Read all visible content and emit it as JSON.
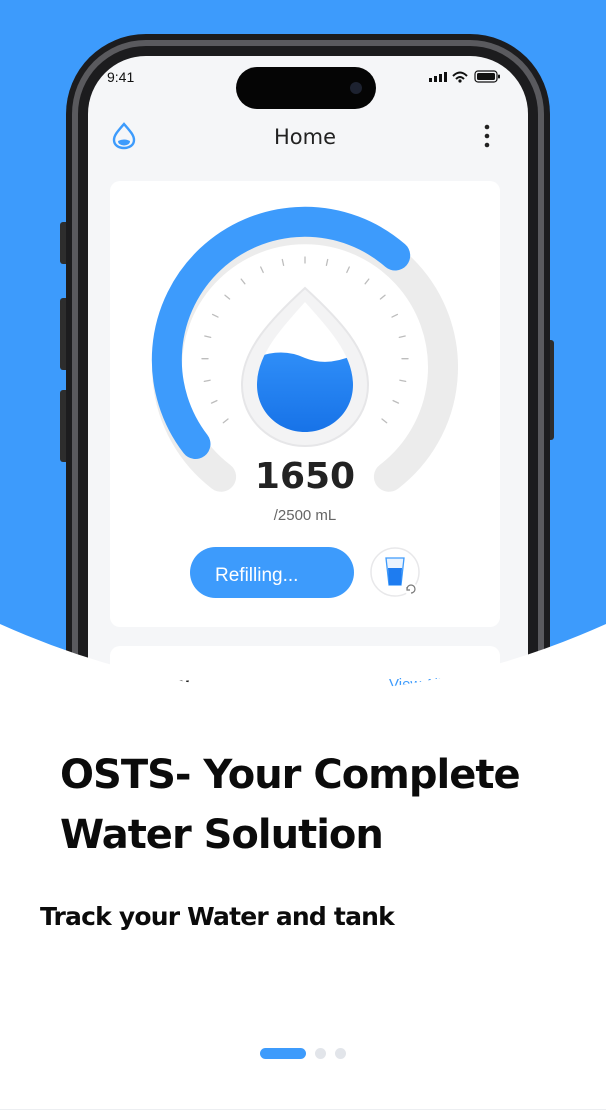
{
  "colors": {
    "brand": "#3d9bfc",
    "gauge_track": "#ececec",
    "card": "#ffffff",
    "text_dark": "#222222"
  },
  "phone": {
    "status_time": "9:41",
    "app_bar": {
      "logo_icon": "water-drop-icon",
      "title": "Home",
      "menu_icon": "more-vert-icon"
    },
    "gauge": {
      "value": "1650",
      "goal": "/2500 mL",
      "fill_fraction": 0.66
    },
    "refill_button": "Refilling...",
    "cup_icon": "glass-refresh-icon",
    "history": {
      "title": "History",
      "view_all": "View All"
    }
  },
  "onboarding": {
    "headline_lines": [
      "OSTS- Your Complete",
      "Water Solution"
    ],
    "subtitle": "Track your Water and tank",
    "pages": {
      "count": 3,
      "active": 0
    }
  }
}
